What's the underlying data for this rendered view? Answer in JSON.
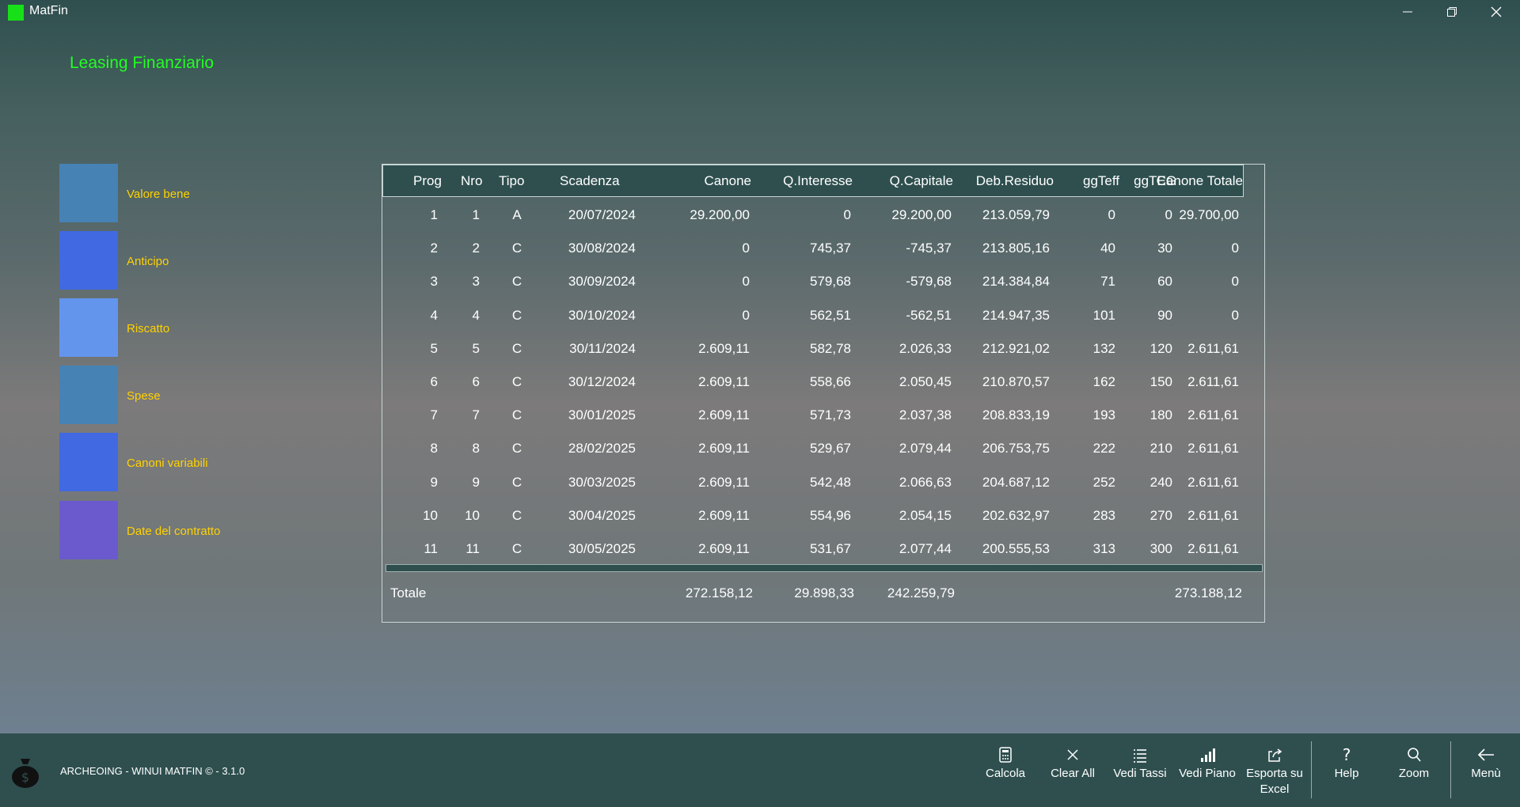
{
  "app": {
    "title": "MatFin"
  },
  "page": {
    "title": "Leasing Finanziario"
  },
  "sidebar": {
    "items": [
      {
        "label": "Valore bene",
        "color": "#4682b4"
      },
      {
        "label": "Anticipo",
        "color": "#4169e1"
      },
      {
        "label": "Riscatto",
        "color": "#6495ed"
      },
      {
        "label": "Spese",
        "color": "#4682b4"
      },
      {
        "label": "Canoni variabili",
        "color": "#4169e1"
      },
      {
        "label": "Date del contratto",
        "color": "#6a5acd"
      }
    ]
  },
  "table": {
    "headers": {
      "prog": "Prog",
      "nro": "Nro",
      "tipo": "Tipo",
      "scadenza": "Scadenza",
      "canone": "Canone",
      "qinteresse": "Q.Interesse",
      "qcapitale": "Q.Capitale",
      "debresiduo": "Deb.Residuo",
      "ggteff": "ggTeff",
      "ggteg": "ggTEG",
      "canonetotale": "Canone Totale"
    },
    "rows": [
      [
        "1",
        "1",
        "A",
        "20/07/2024",
        "29.200,00",
        "0",
        "29.200,00",
        "213.059,79",
        "0",
        "0",
        "29.700,00"
      ],
      [
        "2",
        "2",
        "C",
        "30/08/2024",
        "0",
        "745,37",
        "-745,37",
        "213.805,16",
        "40",
        "30",
        "0"
      ],
      [
        "3",
        "3",
        "C",
        "30/09/2024",
        "0",
        "579,68",
        "-579,68",
        "214.384,84",
        "71",
        "60",
        "0"
      ],
      [
        "4",
        "4",
        "C",
        "30/10/2024",
        "0",
        "562,51",
        "-562,51",
        "214.947,35",
        "101",
        "90",
        "0"
      ],
      [
        "5",
        "5",
        "C",
        "30/11/2024",
        "2.609,11",
        "582,78",
        "2.026,33",
        "212.921,02",
        "132",
        "120",
        "2.611,61"
      ],
      [
        "6",
        "6",
        "C",
        "30/12/2024",
        "2.609,11",
        "558,66",
        "2.050,45",
        "210.870,57",
        "162",
        "150",
        "2.611,61"
      ],
      [
        "7",
        "7",
        "C",
        "30/01/2025",
        "2.609,11",
        "571,73",
        "2.037,38",
        "208.833,19",
        "193",
        "180",
        "2.611,61"
      ],
      [
        "8",
        "8",
        "C",
        "28/02/2025",
        "2.609,11",
        "529,67",
        "2.079,44",
        "206.753,75",
        "222",
        "210",
        "2.611,61"
      ],
      [
        "9",
        "9",
        "C",
        "30/03/2025",
        "2.609,11",
        "542,48",
        "2.066,63",
        "204.687,12",
        "252",
        "240",
        "2.611,61"
      ],
      [
        "10",
        "10",
        "C",
        "30/04/2025",
        "2.609,11",
        "554,96",
        "2.054,15",
        "202.632,97",
        "283",
        "270",
        "2.611,61"
      ],
      [
        "11",
        "11",
        "C",
        "30/05/2025",
        "2.609,11",
        "531,67",
        "2.077,44",
        "200.555,53",
        "313",
        "300",
        "2.611,61"
      ]
    ],
    "totals": {
      "label": "Totale",
      "canone": "272.158,12",
      "qinteresse": "29.898,33",
      "qcapitale": "242.259,79",
      "canonetotale": "273.188,12"
    }
  },
  "footer": {
    "status": "ARCHEOING - WINUI MATFIN © - 3.1.0"
  },
  "commands": {
    "calcola": "Calcola",
    "clear_all": "Clear All",
    "vedi_tassi": "Vedi Tassi",
    "vedi_piano": "Vedi Piano",
    "esporta_excel": "Esporta su Excel",
    "help": "Help",
    "zoom": "Zoom",
    "menu": "Menù"
  }
}
